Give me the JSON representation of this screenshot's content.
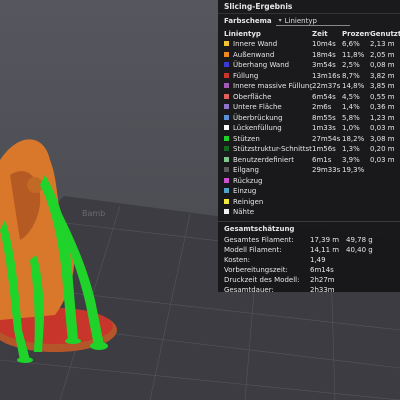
{
  "panel": {
    "title": "Slicing-Ergebnis",
    "scheme_label": "Farbschema",
    "scheme_value": "Linientyp",
    "headers": {
      "name": "Linientyp",
      "time": "Zeit",
      "percent": "Prozent",
      "length": "Genutzt"
    },
    "rows": [
      {
        "name": "Innere Wand",
        "color": "#f2c230",
        "time": "10m4s",
        "percent": "6,6%",
        "length": "2,13 m"
      },
      {
        "name": "Außenwand",
        "color": "#f08a1e",
        "time": "18m4s",
        "percent": "11,8%",
        "length": "2,05 m"
      },
      {
        "name": "Überhang Wand",
        "color": "#3b3bd1",
        "time": "3m54s",
        "percent": "2,5%",
        "length": "0,08 m"
      },
      {
        "name": "Füllung",
        "color": "#c8352a",
        "time": "13m16s",
        "percent": "8,7%",
        "length": "3,82 m"
      },
      {
        "name": "Innere massive Füllung",
        "color": "#a45ab5",
        "time": "22m37s",
        "percent": "14,8%",
        "length": "3,85 m"
      },
      {
        "name": "Oberfläche",
        "color": "#e0605a",
        "time": "6m54s",
        "percent": "4,5%",
        "length": "0,55 m"
      },
      {
        "name": "Untere Fläche",
        "color": "#8f72c9",
        "time": "2m6s",
        "percent": "1,4%",
        "length": "0,36 m"
      },
      {
        "name": "Überbrückung",
        "color": "#5b8fd6",
        "time": "8m55s",
        "percent": "5,8%",
        "length": "1,23 m"
      },
      {
        "name": "Lückenfüllung",
        "color": "#ffffff",
        "time": "1m33s",
        "percent": "1,0%",
        "length": "0,03 m"
      },
      {
        "name": "Stützen",
        "color": "#1fd02a",
        "time": "27m54s",
        "percent": "18,2%",
        "length": "3,08 m"
      },
      {
        "name": "Stützstruktur-Schnittstelle",
        "color": "#146b1f",
        "time": "1m56s",
        "percent": "1,3%",
        "length": "0,20 m"
      },
      {
        "name": "Benutzerdefiniert",
        "color": "#7fc98a",
        "time": "6m1s",
        "percent": "3,9%",
        "length": "0,03 m"
      },
      {
        "name": "Eilgang",
        "color": "#5a5a5a",
        "time": "29m33s",
        "percent": "19,3%",
        "length": ""
      },
      {
        "name": "Rückzug",
        "color": "#cf4fcf",
        "time": "",
        "percent": "",
        "length": ""
      },
      {
        "name": "Einzug",
        "color": "#4fa3c9",
        "time": "",
        "percent": "",
        "length": ""
      },
      {
        "name": "Reinigen",
        "color": "#f4ea3c",
        "time": "",
        "percent": "",
        "length": ""
      },
      {
        "name": "Nähte",
        "color": "#f2f2f2",
        "time": "",
        "percent": "",
        "length": ""
      }
    ],
    "summary_title": "Gesamtschätzung",
    "summary": [
      {
        "label": "Gesamtes Filament:",
        "v1": "17,39 m",
        "v2": "49,78 g"
      },
      {
        "label": "Modell Filament:",
        "v1": "14,11 m",
        "v2": "40,40 g"
      },
      {
        "label": "Kosten:",
        "v1": "1,49",
        "v2": ""
      },
      {
        "label": "Vorbereitungszeit:",
        "v1": "6m14s",
        "v2": ""
      },
      {
        "label": "Druckzeit des Modell:",
        "v1": "2h27m",
        "v2": ""
      },
      {
        "label": "Gesamtdauer:",
        "v1": "2h33m",
        "v2": ""
      }
    ]
  },
  "viewport": {
    "plate_color": "#3a3a40",
    "model_color": "#d9782b",
    "support_color": "#20d32b",
    "infill_color": "#c8352a"
  }
}
